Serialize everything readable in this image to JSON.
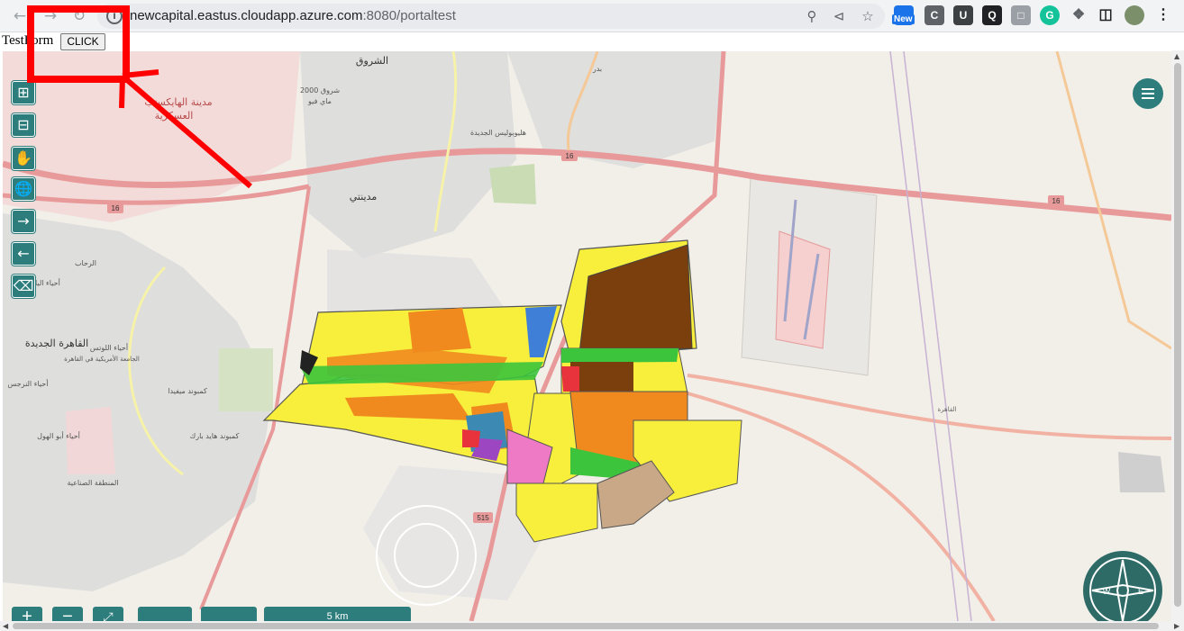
{
  "browser": {
    "url_host": "newcapital.eastus.cloudapp.azure.com",
    "url_path": ":8080/portaltest",
    "new_badge": "New"
  },
  "page": {
    "test_label": "TestForm",
    "click_button": "CLICK"
  },
  "map": {
    "labels": {
      "shorouk": "الشروق",
      "shorouk2000": "شروق 2000",
      "haikstep": "مدينة الهايكستب",
      "askariya": "العسكرية",
      "heliopolis": "هليوبوليس الجديدة",
      "madinaty": "مدينتي",
      "newcairo": "القاهرة الجديدة",
      "badr": "بدر",
      "rehab": "الرحاب",
      "lotus": "أحياء اللوتس",
      "auc": "الجامعة الأمريكية في القاهرة",
      "industrial": "المنطقة الصناعية",
      "yasmin": "أحياء الياسمين",
      "narges": "أحياء النرجس",
      "abulhoul": "أحياء أبو الهول",
      "kompound": "كمبوند هايد بارك",
      "marasem": "كمبوند ميفيدا",
      "airport": "القاهرة",
      "road16a": "16",
      "road16b": "16",
      "road16c": "16",
      "road515": "515",
      "shorouk_small": "ماي فيو"
    },
    "tools": [
      "zoom-in",
      "zoom-out",
      "pan",
      "globe",
      "forward",
      "back",
      "eraser"
    ],
    "scale_label": "5 km",
    "compass": {
      "west": "W",
      "east": "E"
    }
  }
}
